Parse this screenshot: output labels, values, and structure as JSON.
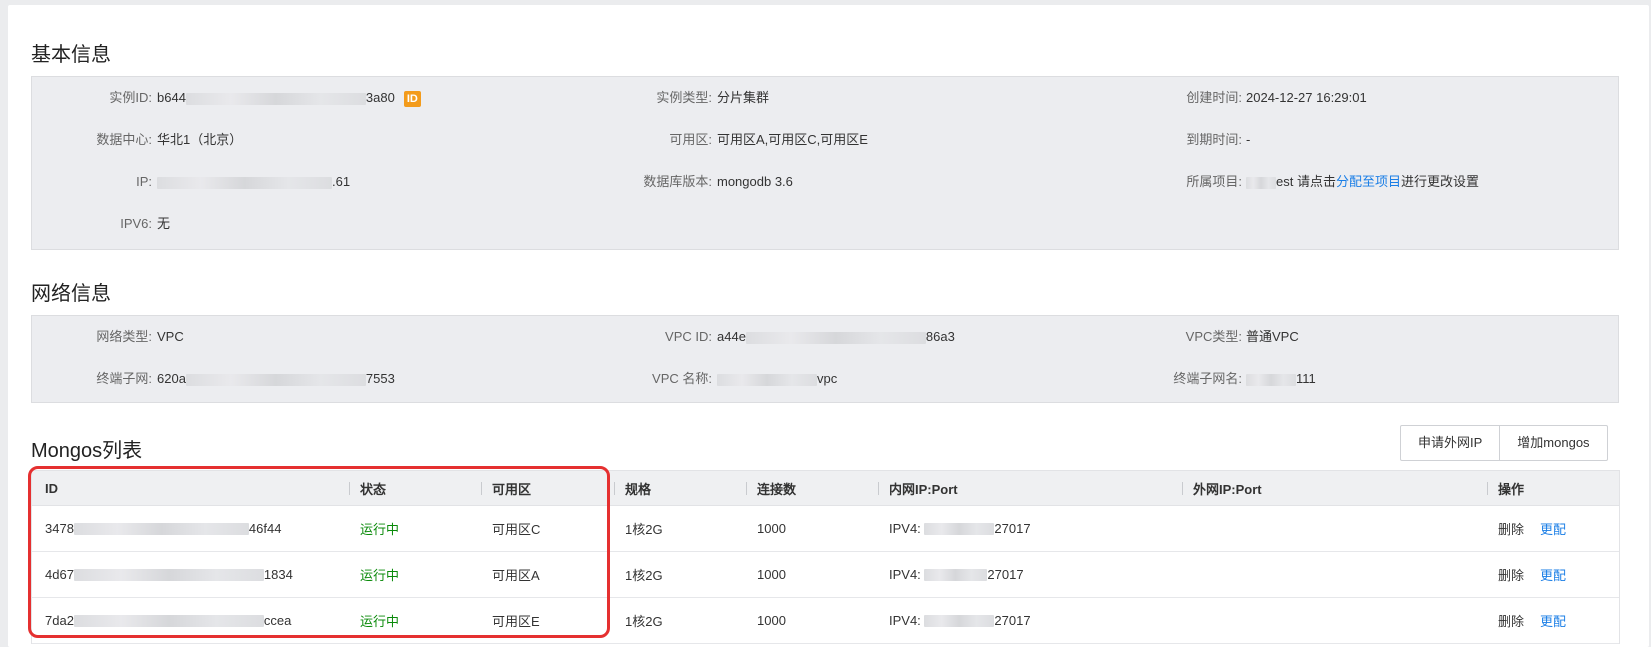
{
  "basic": {
    "title": "基本信息",
    "instance_id_label": "实例ID:",
    "instance_id_prefix": "b644",
    "instance_id_suffix": "3a80",
    "id_badge": "ID",
    "instance_type_label": "实例类型:",
    "instance_type": "分片集群",
    "created_label": "创建时间:",
    "created": "2024-12-27 16:29:01",
    "dc_label": "数据中心:",
    "dc": "华北1（北京）",
    "zone_label": "可用区:",
    "zone": "可用区A,可用区C,可用区E",
    "expire_label": "到期时间:",
    "expire": "-",
    "ip_label": "IP:",
    "ip_suffix": ".61",
    "db_version_label": "数据库版本:",
    "db_version": "mongodb 3.6",
    "project_label": "所属项目:",
    "project_suffix": "est",
    "project_hint_pre": " 请点击",
    "project_link": "分配至项目",
    "project_hint_post": "进行更改设置",
    "ipv6_label": "IPV6:",
    "ipv6": "无"
  },
  "network": {
    "title": "网络信息",
    "net_type_label": "网络类型:",
    "net_type": "VPC",
    "vpc_id_label": "VPC ID:",
    "vpc_id_prefix": "a44e",
    "vpc_id_suffix": "86a3",
    "vpc_type_label": "VPC类型:",
    "vpc_type": "普通VPC",
    "subnet_label": "终端子网:",
    "subnet_prefix": "620a",
    "subnet_suffix": "7553",
    "vpc_name_label": "VPC 名称:",
    "vpc_name_suffix": "vpc",
    "subnet_name_label": "终端子网名:",
    "subnet_name_suffix": "111"
  },
  "mongos": {
    "title": "Mongos列表",
    "btn_public_ip": "申请外网IP",
    "btn_add": "增加mongos",
    "headers": [
      "ID",
      "状态",
      "可用区",
      "规格",
      "连接数",
      "内网IP:Port",
      "外网IP:Port",
      "操作"
    ],
    "rows": [
      {
        "id_prefix": "3478",
        "id_suffix": "46f44",
        "status": "运行中",
        "zone": "可用区C",
        "spec": "1核2G",
        "conn": "1000",
        "ip_prefix": "IPV4:",
        "port": "27017",
        "public": "",
        "del": "删除",
        "change": "更配"
      },
      {
        "id_prefix": "4d67",
        "id_suffix": "1834",
        "status": "运行中",
        "zone": "可用区A",
        "spec": "1核2G",
        "conn": "1000",
        "ip_prefix": "IPV4:",
        "port": "27017",
        "public": "",
        "del": "删除",
        "change": "更配"
      },
      {
        "id_prefix": "7da2",
        "id_suffix": "ccea",
        "status": "运行中",
        "zone": "可用区E",
        "spec": "1核2G",
        "conn": "1000",
        "ip_prefix": "IPV4:",
        "port": "27017",
        "public": "",
        "del": "删除",
        "change": "更配"
      }
    ]
  },
  "colors": {
    "link": "#1a7ee6",
    "status_running": "#0a8a0a",
    "badge": "#f39b1b",
    "highlight_border": "#e53030"
  }
}
